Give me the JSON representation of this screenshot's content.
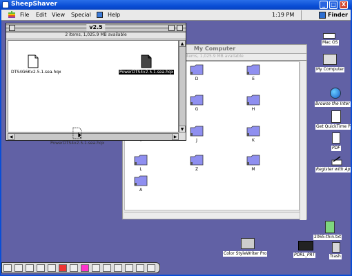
{
  "host_window": {
    "title": "SheepShaver",
    "buttons": {
      "minimize": "_",
      "maximize": "□",
      "close": "X"
    }
  },
  "menubar": {
    "items": [
      "File",
      "Edit",
      "View",
      "Special",
      "Help"
    ],
    "clock": "1:19 PM",
    "app_menu": "Finder"
  },
  "window_v25": {
    "title": "v2.5",
    "info": "2 items, 1,025.9 MB available",
    "files": [
      {
        "name": "DTS4G6Kv2.5.1.sea.hqx",
        "selected": false
      },
      {
        "name": "PowerDTS4v2.5.1.sea.hqx",
        "selected": true
      }
    ]
  },
  "window_mycomputer": {
    "title": "My Computer",
    "info": "items, 1,025.9 MB available",
    "drives": [
      "D",
      "E",
      "G",
      "H",
      "I",
      "J",
      "K",
      "L",
      "Z",
      "M",
      "A"
    ]
  },
  "dragging": {
    "name": "PowerDTS4v2.5.1.sea.hqx"
  },
  "desktop_icons": {
    "mac_os": "Mac OS",
    "my_computer": "My Computer",
    "browse": "Browse the Inter",
    "quicktime": "Get QuickTime P",
    "pdf": "PDF",
    "register": "Register with Ap",
    "readme": "2065-thin.txt",
    "trash": "Trash",
    "color_stylewriter": "Color StyleWriter Pro",
    "printer2": "PORL_PRT"
  },
  "colors": {
    "desktop": "#6161a5",
    "xp_title": "#0a4ed6",
    "folder": "#8f8ff0"
  }
}
